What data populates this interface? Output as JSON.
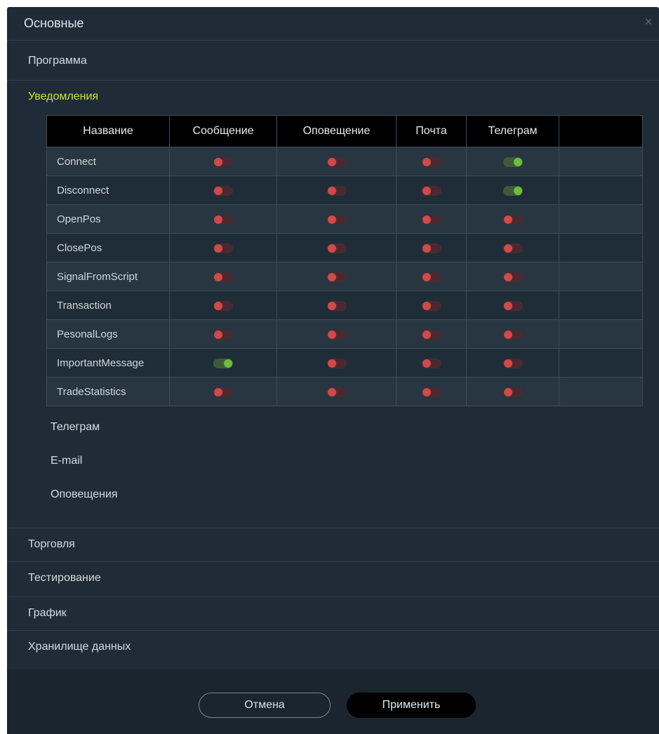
{
  "dialog": {
    "title": "Основные",
    "close_symbol": "×"
  },
  "sections": {
    "program": "Программа",
    "notifications": "Уведомления",
    "trading": "Торговля",
    "testing": "Тестирование",
    "chart": "График",
    "data_storage": "Хранилище данных"
  },
  "notifications": {
    "columns": [
      "Название",
      "Сообщение",
      "Оповещение",
      "Почта",
      "Телеграм",
      ""
    ],
    "rows": [
      {
        "name": "Connect",
        "message": false,
        "alert": false,
        "mail": false,
        "telegram": true
      },
      {
        "name": "Disconnect",
        "message": false,
        "alert": false,
        "mail": false,
        "telegram": true
      },
      {
        "name": "OpenPos",
        "message": false,
        "alert": false,
        "mail": false,
        "telegram": false
      },
      {
        "name": "ClosePos",
        "message": false,
        "alert": false,
        "mail": false,
        "telegram": false
      },
      {
        "name": "SignalFromScript",
        "message": false,
        "alert": false,
        "mail": false,
        "telegram": false
      },
      {
        "name": "Transaction",
        "message": false,
        "alert": false,
        "mail": false,
        "telegram": false
      },
      {
        "name": "PesonalLogs",
        "message": false,
        "alert": false,
        "mail": false,
        "telegram": false
      },
      {
        "name": "ImportantMessage",
        "message": true,
        "alert": false,
        "mail": false,
        "telegram": false
      },
      {
        "name": "TradeStatistics",
        "message": false,
        "alert": false,
        "mail": false,
        "telegram": false
      }
    ],
    "subsections": [
      "Телеграм",
      "E-mail",
      "Оповещения"
    ]
  },
  "footer": {
    "cancel_label": "Отмена",
    "apply_label": "Применить"
  },
  "colors": {
    "background": "#1f2c37",
    "accent_active": "#cfe33a",
    "toggle_on": "#6fbd3c",
    "toggle_off": "#cf4a4a"
  }
}
